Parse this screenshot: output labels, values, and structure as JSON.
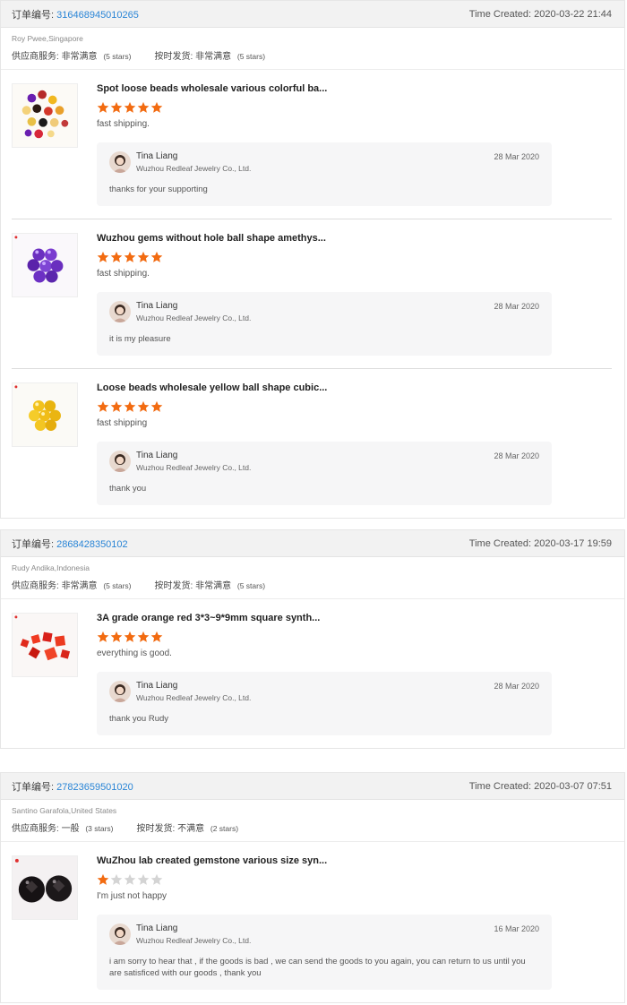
{
  "orders": [
    {
      "order_label": "订单编号:",
      "order_number": "316468945010265",
      "time_created": "Time Created: 2020-03-22 21:44",
      "buyer": "Roy Pwee,Singapore",
      "supplier_service": {
        "label": "供应商服务:",
        "value": "非常满意",
        "stars": "(5 stars)"
      },
      "on_time_shipping": {
        "label": "按时发货:",
        "value": "非常满意",
        "stars": "(5 stars)"
      },
      "items": [
        {
          "title": "Spot loose beads wholesale various colorful ba...",
          "rating": 5,
          "comment": "fast shipping.",
          "reply": {
            "name": "Tina Liang",
            "company": "Wuzhou Redleaf Jewelry Co., Ltd.",
            "date": "28 Mar 2020",
            "text": "thanks for your supporting"
          }
        },
        {
          "title": "Wuzhou gems without hole ball shape amethys...",
          "rating": 5,
          "comment": "fast shipping.",
          "reply": {
            "name": "Tina Liang",
            "company": "Wuzhou Redleaf Jewelry Co., Ltd.",
            "date": "28 Mar 2020",
            "text": "it is my pleasure"
          }
        },
        {
          "title": "Loose beads wholesale yellow ball shape cubic...",
          "rating": 5,
          "comment": "fast shipping",
          "reply": {
            "name": "Tina Liang",
            "company": "Wuzhou Redleaf Jewelry Co., Ltd.",
            "date": "28 Mar 2020",
            "text": "thank you"
          }
        }
      ]
    },
    {
      "order_label": "订单编号:",
      "order_number": "2868428350102",
      "time_created": "Time Created: 2020-03-17 19:59",
      "buyer": "Rudy Andika,Indonesia",
      "supplier_service": {
        "label": "供应商服务:",
        "value": "非常满意",
        "stars": "(5 stars)"
      },
      "on_time_shipping": {
        "label": "按时发货:",
        "value": "非常满意",
        "stars": "(5 stars)"
      },
      "items": [
        {
          "title": "3A grade orange red 3*3~9*9mm square synth...",
          "rating": 5,
          "comment": "everything is good.",
          "reply": {
            "name": "Tina Liang",
            "company": "Wuzhou Redleaf Jewelry Co., Ltd.",
            "date": "28 Mar 2020",
            "text": "thank you Rudy"
          }
        }
      ]
    },
    {
      "order_label": "订单编号:",
      "order_number": "27823659501020",
      "time_created": "Time Created: 2020-03-07 07:51",
      "buyer": "Santino Garafola,United States",
      "supplier_service": {
        "label": "供应商服务:",
        "value": "一般",
        "stars": "(3 stars)"
      },
      "on_time_shipping": {
        "label": "按时发货:",
        "value": "不满意",
        "stars": "(2 stars)"
      },
      "items": [
        {
          "title": "WuZhou lab created gemstone various size syn...",
          "rating": 1,
          "comment": "I'm just not happy",
          "reply": {
            "name": "Tina Liang",
            "company": "Wuzhou Redleaf Jewelry Co., Ltd.",
            "date": "16 Mar 2020",
            "text": "i am sorry to hear that , if the goods is bad , we can send the goods to you again, you can return to us until you are satisficed with our goods , thank you"
          }
        }
      ]
    }
  ],
  "colors": {
    "star_on": "#f26b11",
    "star_off": "#d4d4d4",
    "link": "#2a85d6"
  }
}
